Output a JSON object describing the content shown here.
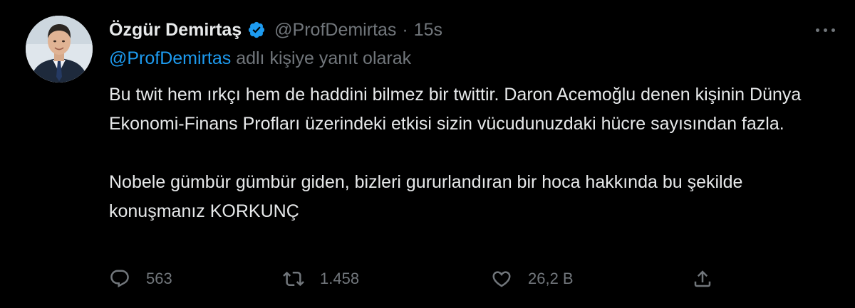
{
  "author": {
    "display_name": "Özgür Demirtaş",
    "handle": "@ProfDemirtas",
    "separator": "·",
    "time": "15s"
  },
  "reply_context": {
    "mention": "@ProfDemirtas",
    "suffix": " adlı kişiye yanıt olarak"
  },
  "tweet": {
    "paragraph_1": "Bu twit hem ırkçı hem de haddini bilmez bir twittir. Daron Acemoğlu denen kişinin Dünya Ekonomi-Finans Profları üzerindeki etkisi sizin vücudunuzdaki hücre sayısından fazla.",
    "paragraph_2": "Nobele gümbür gümbür giden, bizleri gururlandıran bir hoca hakkında bu şekilde konuşmanız KORKUNÇ"
  },
  "actions": {
    "replies": "563",
    "retweets": "1.458",
    "likes": "26,2 B"
  },
  "icons": {
    "verified": "verified-badge-icon",
    "more": "more-dots-icon",
    "reply": "reply-bubble-icon",
    "retweet": "retweet-icon",
    "like": "heart-icon",
    "share": "share-icon"
  },
  "colors": {
    "background": "#000000",
    "text": "#e7e9ea",
    "muted": "#71767b",
    "accent": "#1d9bf0"
  }
}
